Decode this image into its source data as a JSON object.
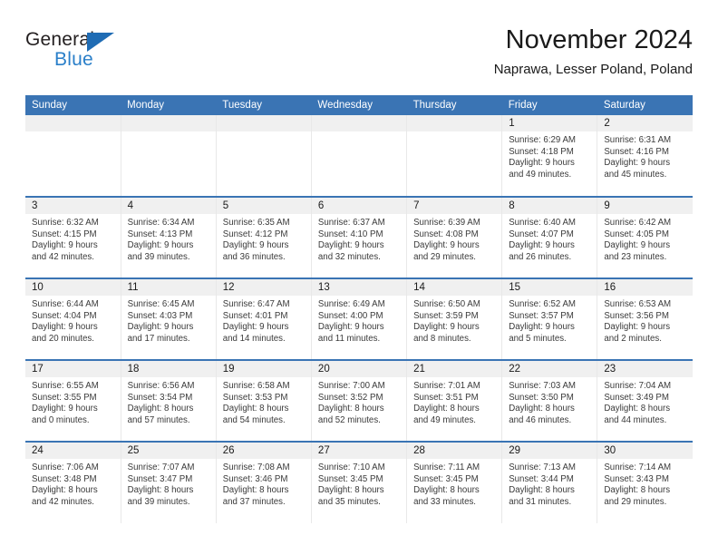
{
  "brand": {
    "name_top": "General",
    "name_bottom": "Blue",
    "triangle_icon": "triangle-icon",
    "color_dark": "#231f20",
    "color_blue": "#2a7fc9"
  },
  "header": {
    "title": "November 2024",
    "subtitle": "Naprawa, Lesser Poland, Poland"
  },
  "theme": {
    "header_blue": "#3a74b4",
    "band_gray": "#f0f0f0",
    "grid_line": "#e8e8e8"
  },
  "calendar": {
    "weekday_headers": [
      "Sunday",
      "Monday",
      "Tuesday",
      "Wednesday",
      "Thursday",
      "Friday",
      "Saturday"
    ],
    "weeks": [
      [
        {
          "day": "",
          "sunrise": "",
          "sunset": "",
          "daylight_line1": "",
          "daylight_line2": ""
        },
        {
          "day": "",
          "sunrise": "",
          "sunset": "",
          "daylight_line1": "",
          "daylight_line2": ""
        },
        {
          "day": "",
          "sunrise": "",
          "sunset": "",
          "daylight_line1": "",
          "daylight_line2": ""
        },
        {
          "day": "",
          "sunrise": "",
          "sunset": "",
          "daylight_line1": "",
          "daylight_line2": ""
        },
        {
          "day": "",
          "sunrise": "",
          "sunset": "",
          "daylight_line1": "",
          "daylight_line2": ""
        },
        {
          "day": "1",
          "sunrise": "Sunrise: 6:29 AM",
          "sunset": "Sunset: 4:18 PM",
          "daylight_line1": "Daylight: 9 hours",
          "daylight_line2": "and 49 minutes."
        },
        {
          "day": "2",
          "sunrise": "Sunrise: 6:31 AM",
          "sunset": "Sunset: 4:16 PM",
          "daylight_line1": "Daylight: 9 hours",
          "daylight_line2": "and 45 minutes."
        }
      ],
      [
        {
          "day": "3",
          "sunrise": "Sunrise: 6:32 AM",
          "sunset": "Sunset: 4:15 PM",
          "daylight_line1": "Daylight: 9 hours",
          "daylight_line2": "and 42 minutes."
        },
        {
          "day": "4",
          "sunrise": "Sunrise: 6:34 AM",
          "sunset": "Sunset: 4:13 PM",
          "daylight_line1": "Daylight: 9 hours",
          "daylight_line2": "and 39 minutes."
        },
        {
          "day": "5",
          "sunrise": "Sunrise: 6:35 AM",
          "sunset": "Sunset: 4:12 PM",
          "daylight_line1": "Daylight: 9 hours",
          "daylight_line2": "and 36 minutes."
        },
        {
          "day": "6",
          "sunrise": "Sunrise: 6:37 AM",
          "sunset": "Sunset: 4:10 PM",
          "daylight_line1": "Daylight: 9 hours",
          "daylight_line2": "and 32 minutes."
        },
        {
          "day": "7",
          "sunrise": "Sunrise: 6:39 AM",
          "sunset": "Sunset: 4:08 PM",
          "daylight_line1": "Daylight: 9 hours",
          "daylight_line2": "and 29 minutes."
        },
        {
          "day": "8",
          "sunrise": "Sunrise: 6:40 AM",
          "sunset": "Sunset: 4:07 PM",
          "daylight_line1": "Daylight: 9 hours",
          "daylight_line2": "and 26 minutes."
        },
        {
          "day": "9",
          "sunrise": "Sunrise: 6:42 AM",
          "sunset": "Sunset: 4:05 PM",
          "daylight_line1": "Daylight: 9 hours",
          "daylight_line2": "and 23 minutes."
        }
      ],
      [
        {
          "day": "10",
          "sunrise": "Sunrise: 6:44 AM",
          "sunset": "Sunset: 4:04 PM",
          "daylight_line1": "Daylight: 9 hours",
          "daylight_line2": "and 20 minutes."
        },
        {
          "day": "11",
          "sunrise": "Sunrise: 6:45 AM",
          "sunset": "Sunset: 4:03 PM",
          "daylight_line1": "Daylight: 9 hours",
          "daylight_line2": "and 17 minutes."
        },
        {
          "day": "12",
          "sunrise": "Sunrise: 6:47 AM",
          "sunset": "Sunset: 4:01 PM",
          "daylight_line1": "Daylight: 9 hours",
          "daylight_line2": "and 14 minutes."
        },
        {
          "day": "13",
          "sunrise": "Sunrise: 6:49 AM",
          "sunset": "Sunset: 4:00 PM",
          "daylight_line1": "Daylight: 9 hours",
          "daylight_line2": "and 11 minutes."
        },
        {
          "day": "14",
          "sunrise": "Sunrise: 6:50 AM",
          "sunset": "Sunset: 3:59 PM",
          "daylight_line1": "Daylight: 9 hours",
          "daylight_line2": "and 8 minutes."
        },
        {
          "day": "15",
          "sunrise": "Sunrise: 6:52 AM",
          "sunset": "Sunset: 3:57 PM",
          "daylight_line1": "Daylight: 9 hours",
          "daylight_line2": "and 5 minutes."
        },
        {
          "day": "16",
          "sunrise": "Sunrise: 6:53 AM",
          "sunset": "Sunset: 3:56 PM",
          "daylight_line1": "Daylight: 9 hours",
          "daylight_line2": "and 2 minutes."
        }
      ],
      [
        {
          "day": "17",
          "sunrise": "Sunrise: 6:55 AM",
          "sunset": "Sunset: 3:55 PM",
          "daylight_line1": "Daylight: 9 hours",
          "daylight_line2": "and 0 minutes."
        },
        {
          "day": "18",
          "sunrise": "Sunrise: 6:56 AM",
          "sunset": "Sunset: 3:54 PM",
          "daylight_line1": "Daylight: 8 hours",
          "daylight_line2": "and 57 minutes."
        },
        {
          "day": "19",
          "sunrise": "Sunrise: 6:58 AM",
          "sunset": "Sunset: 3:53 PM",
          "daylight_line1": "Daylight: 8 hours",
          "daylight_line2": "and 54 minutes."
        },
        {
          "day": "20",
          "sunrise": "Sunrise: 7:00 AM",
          "sunset": "Sunset: 3:52 PM",
          "daylight_line1": "Daylight: 8 hours",
          "daylight_line2": "and 52 minutes."
        },
        {
          "day": "21",
          "sunrise": "Sunrise: 7:01 AM",
          "sunset": "Sunset: 3:51 PM",
          "daylight_line1": "Daylight: 8 hours",
          "daylight_line2": "and 49 minutes."
        },
        {
          "day": "22",
          "sunrise": "Sunrise: 7:03 AM",
          "sunset": "Sunset: 3:50 PM",
          "daylight_line1": "Daylight: 8 hours",
          "daylight_line2": "and 46 minutes."
        },
        {
          "day": "23",
          "sunrise": "Sunrise: 7:04 AM",
          "sunset": "Sunset: 3:49 PM",
          "daylight_line1": "Daylight: 8 hours",
          "daylight_line2": "and 44 minutes."
        }
      ],
      [
        {
          "day": "24",
          "sunrise": "Sunrise: 7:06 AM",
          "sunset": "Sunset: 3:48 PM",
          "daylight_line1": "Daylight: 8 hours",
          "daylight_line2": "and 42 minutes."
        },
        {
          "day": "25",
          "sunrise": "Sunrise: 7:07 AM",
          "sunset": "Sunset: 3:47 PM",
          "daylight_line1": "Daylight: 8 hours",
          "daylight_line2": "and 39 minutes."
        },
        {
          "day": "26",
          "sunrise": "Sunrise: 7:08 AM",
          "sunset": "Sunset: 3:46 PM",
          "daylight_line1": "Daylight: 8 hours",
          "daylight_line2": "and 37 minutes."
        },
        {
          "day": "27",
          "sunrise": "Sunrise: 7:10 AM",
          "sunset": "Sunset: 3:45 PM",
          "daylight_line1": "Daylight: 8 hours",
          "daylight_line2": "and 35 minutes."
        },
        {
          "day": "28",
          "sunrise": "Sunrise: 7:11 AM",
          "sunset": "Sunset: 3:45 PM",
          "daylight_line1": "Daylight: 8 hours",
          "daylight_line2": "and 33 minutes."
        },
        {
          "day": "29",
          "sunrise": "Sunrise: 7:13 AM",
          "sunset": "Sunset: 3:44 PM",
          "daylight_line1": "Daylight: 8 hours",
          "daylight_line2": "and 31 minutes."
        },
        {
          "day": "30",
          "sunrise": "Sunrise: 7:14 AM",
          "sunset": "Sunset: 3:43 PM",
          "daylight_line1": "Daylight: 8 hours",
          "daylight_line2": "and 29 minutes."
        }
      ]
    ]
  }
}
